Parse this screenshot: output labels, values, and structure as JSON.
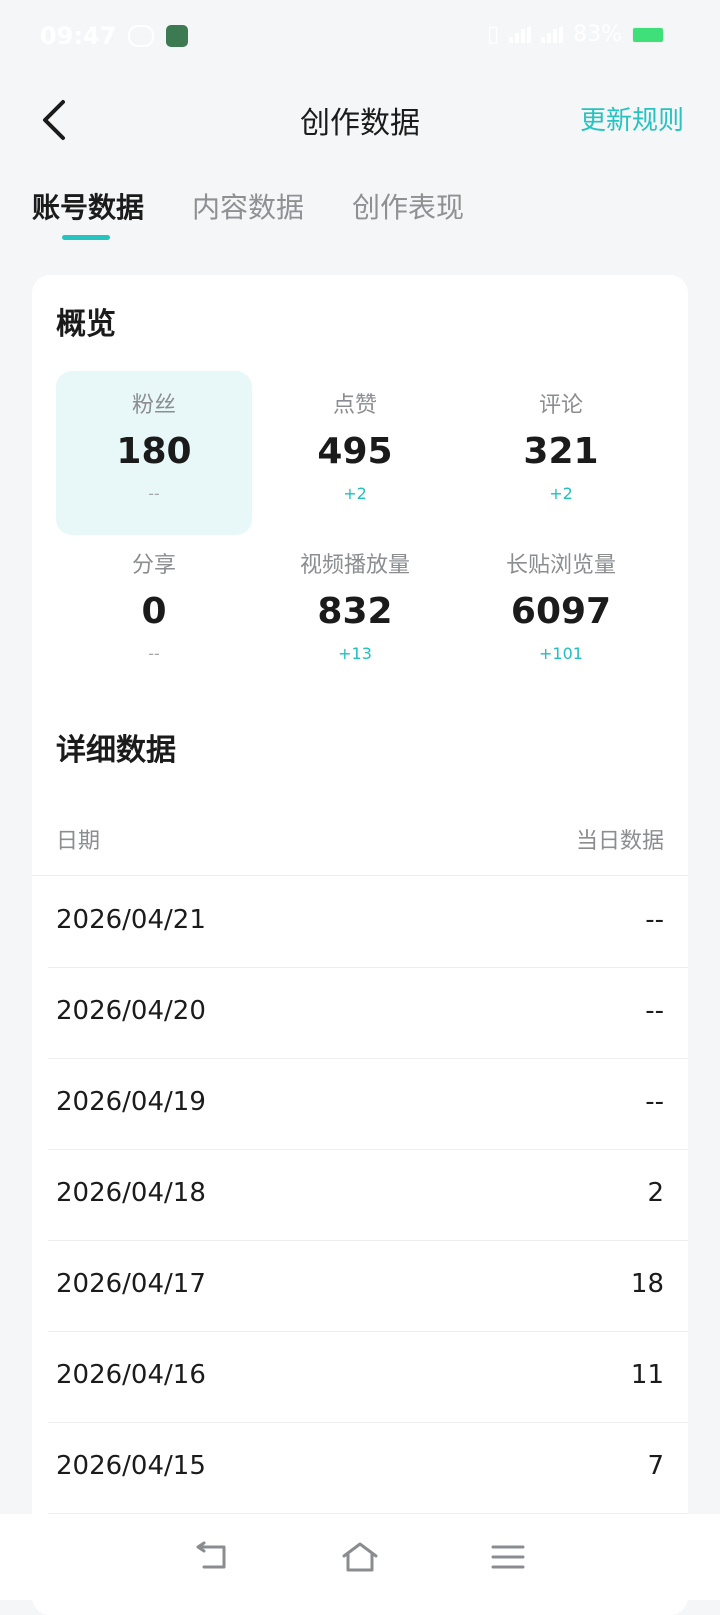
{
  "status": {
    "time": "09:47",
    "battery": "83%"
  },
  "nav": {
    "title": "创作数据",
    "right_link": "更新规则"
  },
  "tabs": [
    {
      "label": "账号数据"
    },
    {
      "label": "内容数据"
    },
    {
      "label": "创作表现"
    }
  ],
  "overview": {
    "title": "概览",
    "metrics": [
      {
        "label": "粉丝",
        "value": "180",
        "delta": "--"
      },
      {
        "label": "点赞",
        "value": "495",
        "delta": "+2"
      },
      {
        "label": "评论",
        "value": "321",
        "delta": "+2"
      },
      {
        "label": "分享",
        "value": "0",
        "delta": "--"
      },
      {
        "label": "视频播放量",
        "value": "832",
        "delta": "+13"
      },
      {
        "label": "长贴浏览量",
        "value": "6097",
        "delta": "+101"
      }
    ]
  },
  "details": {
    "title": "详细数据",
    "col_date": "日期",
    "col_value": "当日数据",
    "rows": [
      {
        "date": "2026/04/21",
        "value": "--"
      },
      {
        "date": "2026/04/20",
        "value": "--"
      },
      {
        "date": "2026/04/19",
        "value": "--"
      },
      {
        "date": "2026/04/18",
        "value": "2"
      },
      {
        "date": "2026/04/17",
        "value": "18"
      },
      {
        "date": "2026/04/16",
        "value": "11"
      },
      {
        "date": "2026/04/15",
        "value": "7"
      }
    ]
  },
  "colors": {
    "accent": "#27c3c0",
    "highlight_bg": "#e8f8f8"
  }
}
